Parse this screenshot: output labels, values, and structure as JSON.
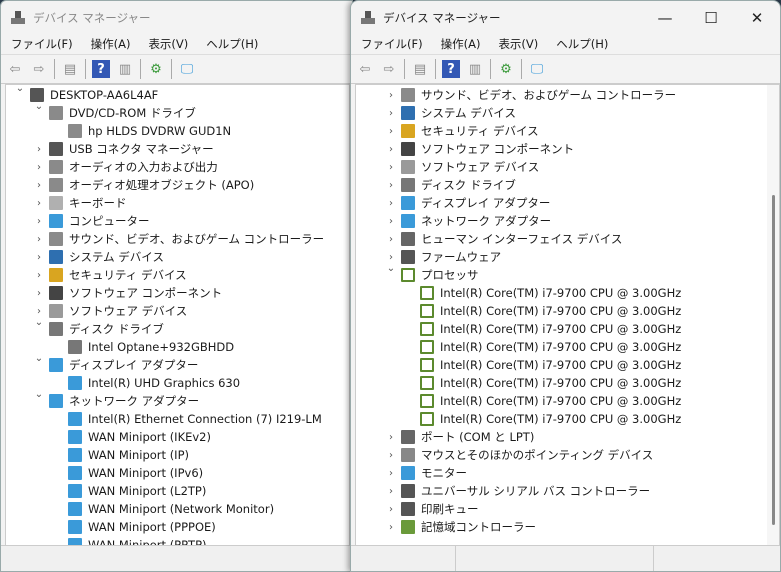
{
  "window_title": "デバイス マネージャー",
  "menu": [
    "ファイル(F)",
    "操作(A)",
    "表示(V)",
    "ヘルプ(H)"
  ],
  "left_tree": [
    {
      "d": 0,
      "a": "v",
      "i": "computer",
      "t": "DESKTOP-AA6L4AF"
    },
    {
      "d": 1,
      "a": "v",
      "i": "dvd",
      "t": "DVD/CD-ROM ドライブ"
    },
    {
      "d": 2,
      "a": "",
      "i": "dvd",
      "t": "hp HLDS DVDRW  GUD1N"
    },
    {
      "d": 1,
      "a": ">",
      "i": "usb",
      "t": "USB コネクタ マネージャー"
    },
    {
      "d": 1,
      "a": ">",
      "i": "audio",
      "t": "オーディオの入力および出力"
    },
    {
      "d": 1,
      "a": ">",
      "i": "audio",
      "t": "オーディオ処理オブジェクト (APO)"
    },
    {
      "d": 1,
      "a": ">",
      "i": "keyboard",
      "t": "キーボード"
    },
    {
      "d": 1,
      "a": ">",
      "i": "monitor",
      "t": "コンピューター"
    },
    {
      "d": 1,
      "a": ">",
      "i": "audio",
      "t": "サウンド、ビデオ、およびゲーム コントローラー"
    },
    {
      "d": 1,
      "a": ">",
      "i": "system",
      "t": "システム デバイス"
    },
    {
      "d": 1,
      "a": ">",
      "i": "security",
      "t": "セキュリティ デバイス"
    },
    {
      "d": 1,
      "a": ">",
      "i": "component",
      "t": "ソフトウェア コンポーネント"
    },
    {
      "d": 1,
      "a": ">",
      "i": "software",
      "t": "ソフトウェア デバイス"
    },
    {
      "d": 1,
      "a": "v",
      "i": "disk",
      "t": "ディスク ドライブ"
    },
    {
      "d": 2,
      "a": "",
      "i": "disk",
      "t": "Intel Optane+932GBHDD"
    },
    {
      "d": 1,
      "a": "v",
      "i": "display",
      "t": "ディスプレイ アダプター"
    },
    {
      "d": 2,
      "a": "",
      "i": "display",
      "t": "Intel(R) UHD Graphics 630"
    },
    {
      "d": 1,
      "a": "v",
      "i": "network",
      "t": "ネットワーク アダプター"
    },
    {
      "d": 2,
      "a": "",
      "i": "network",
      "t": "Intel(R) Ethernet Connection (7) I219-LM"
    },
    {
      "d": 2,
      "a": "",
      "i": "network",
      "t": "WAN Miniport (IKEv2)"
    },
    {
      "d": 2,
      "a": "",
      "i": "network",
      "t": "WAN Miniport (IP)"
    },
    {
      "d": 2,
      "a": "",
      "i": "network",
      "t": "WAN Miniport (IPv6)"
    },
    {
      "d": 2,
      "a": "",
      "i": "network",
      "t": "WAN Miniport (L2TP)"
    },
    {
      "d": 2,
      "a": "",
      "i": "network",
      "t": "WAN Miniport (Network Monitor)"
    },
    {
      "d": 2,
      "a": "",
      "i": "network",
      "t": "WAN Miniport (PPPOE)"
    },
    {
      "d": 2,
      "a": "",
      "i": "network",
      "t": "WAN Miniport (PPTP)"
    }
  ],
  "right_tree": [
    {
      "d": 1,
      "a": ">",
      "i": "audio",
      "t": "サウンド、ビデオ、およびゲーム コントローラー"
    },
    {
      "d": 1,
      "a": ">",
      "i": "system",
      "t": "システム デバイス"
    },
    {
      "d": 1,
      "a": ">",
      "i": "security",
      "t": "セキュリティ デバイス"
    },
    {
      "d": 1,
      "a": ">",
      "i": "component",
      "t": "ソフトウェア コンポーネント"
    },
    {
      "d": 1,
      "a": ">",
      "i": "software",
      "t": "ソフトウェア デバイス"
    },
    {
      "d": 1,
      "a": ">",
      "i": "disk",
      "t": "ディスク ドライブ"
    },
    {
      "d": 1,
      "a": ">",
      "i": "display",
      "t": "ディスプレイ アダプター"
    },
    {
      "d": 1,
      "a": ">",
      "i": "network",
      "t": "ネットワーク アダプター"
    },
    {
      "d": 1,
      "a": ">",
      "i": "hid",
      "t": "ヒューマン インターフェイス デバイス"
    },
    {
      "d": 1,
      "a": ">",
      "i": "firmware",
      "t": "ファームウェア"
    },
    {
      "d": 1,
      "a": "v",
      "i": "cpu",
      "t": "プロセッサ"
    },
    {
      "d": 2,
      "a": "",
      "i": "cpu",
      "t": "Intel(R) Core(TM) i7-9700 CPU @ 3.00GHz"
    },
    {
      "d": 2,
      "a": "",
      "i": "cpu",
      "t": "Intel(R) Core(TM) i7-9700 CPU @ 3.00GHz"
    },
    {
      "d": 2,
      "a": "",
      "i": "cpu",
      "t": "Intel(R) Core(TM) i7-9700 CPU @ 3.00GHz"
    },
    {
      "d": 2,
      "a": "",
      "i": "cpu",
      "t": "Intel(R) Core(TM) i7-9700 CPU @ 3.00GHz"
    },
    {
      "d": 2,
      "a": "",
      "i": "cpu",
      "t": "Intel(R) Core(TM) i7-9700 CPU @ 3.00GHz"
    },
    {
      "d": 2,
      "a": "",
      "i": "cpu",
      "t": "Intel(R) Core(TM) i7-9700 CPU @ 3.00GHz"
    },
    {
      "d": 2,
      "a": "",
      "i": "cpu",
      "t": "Intel(R) Core(TM) i7-9700 CPU @ 3.00GHz"
    },
    {
      "d": 2,
      "a": "",
      "i": "cpu",
      "t": "Intel(R) Core(TM) i7-9700 CPU @ 3.00GHz"
    },
    {
      "d": 1,
      "a": ">",
      "i": "port",
      "t": "ポート (COM と LPT)"
    },
    {
      "d": 1,
      "a": ">",
      "i": "mouse",
      "t": "マウスとそのほかのポインティング デバイス"
    },
    {
      "d": 1,
      "a": ">",
      "i": "monitor",
      "t": "モニター"
    },
    {
      "d": 1,
      "a": ">",
      "i": "usb",
      "t": "ユニバーサル シリアル バス コントローラー"
    },
    {
      "d": 1,
      "a": ">",
      "i": "printer",
      "t": "印刷キュー"
    },
    {
      "d": 1,
      "a": ">",
      "i": "storage",
      "t": "記憶域コントローラー"
    }
  ],
  "icon_colors": {
    "computer": "#555555",
    "dvd": "#8a8a8a",
    "usb": "#555555",
    "audio": "#8a8a8a",
    "keyboard": "#b0b0b0",
    "monitor": "#3a9ad9",
    "system": "#2e6fb0",
    "security": "#d9a520",
    "component": "#444444",
    "software": "#9a9a9a",
    "disk": "#777777",
    "display": "#3a9ad9",
    "network": "#3a9ad9",
    "hid": "#666666",
    "firmware": "#555555",
    "cpu": "#5c8a2e",
    "port": "#666666",
    "mouse": "#888888",
    "printer": "#555555",
    "storage": "#6a9a3a"
  }
}
